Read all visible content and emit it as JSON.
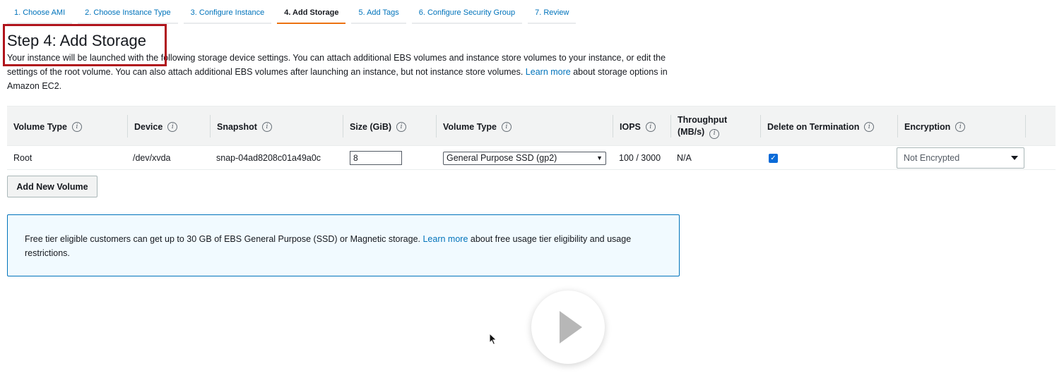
{
  "tabs": [
    {
      "label": "1. Choose AMI",
      "active": false
    },
    {
      "label": "2. Choose Instance Type",
      "active": false
    },
    {
      "label": "3. Configure Instance",
      "active": false
    },
    {
      "label": "4. Add Storage",
      "active": true
    },
    {
      "label": "5. Add Tags",
      "active": false
    },
    {
      "label": "6. Configure Security Group",
      "active": false
    },
    {
      "label": "7. Review",
      "active": false
    }
  ],
  "header": {
    "title": "Step 4: Add Storage",
    "intro_text": "Your instance will be launched with the following storage device settings. You can attach additional EBS volumes and instance store volumes to your instance, or edit the settings of the root volume. You can also attach additional EBS volumes after launching an instance, but not instance store volumes.",
    "learn_more": "Learn more",
    "intro_tail": "about storage options in Amazon EC2."
  },
  "table": {
    "columns": {
      "volume_type": "Volume Type",
      "device": "Device",
      "snapshot": "Snapshot",
      "size": "Size (GiB)",
      "volume_type2": "Volume Type",
      "iops": "IOPS",
      "throughput_line1": "Throughput",
      "throughput_line2": "(MB/s)",
      "delete_on_termination": "Delete on Termination",
      "encryption": "Encryption"
    },
    "row": {
      "volume_type": "Root",
      "device": "/dev/xvda",
      "snapshot": "snap-04ad8208c01a49a0c",
      "size": "8",
      "volume_type_select": "General Purpose SSD (gp2)",
      "iops": "100 / 3000",
      "throughput": "N/A",
      "delete_on_termination": true,
      "encryption": "Not Encrypted"
    }
  },
  "buttons": {
    "add_new_volume": "Add New Volume"
  },
  "info_panel": {
    "text": "Free tier eligible customers can get up to 30 GB of EBS General Purpose (SSD) or Magnetic storage.",
    "learn_more": "Learn more",
    "tail": "about free usage tier eligibility and usage restrictions."
  },
  "colors": {
    "link": "#0073bb",
    "active_tab_underline": "#ec7211",
    "highlight_box": "#b0141c",
    "info_panel_bg": "#f1faff"
  }
}
